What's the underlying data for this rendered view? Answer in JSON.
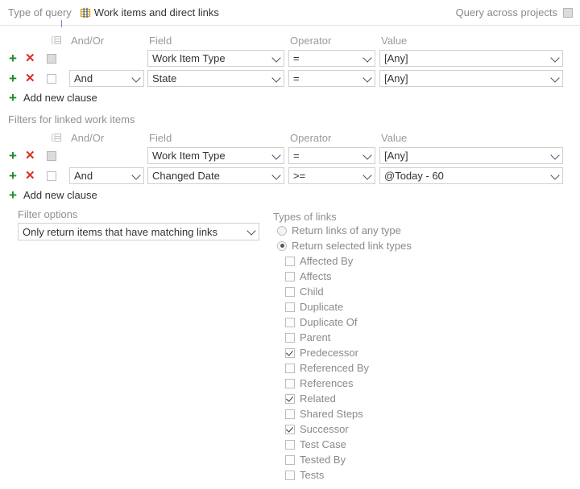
{
  "topbar": {
    "type_of_query_label": "Type of query",
    "query_type_value": "Work items and direct links",
    "query_type_icon": "grid-icon",
    "query_across_projects_label": "Query across projects",
    "query_across_projects_checked": false
  },
  "columns": {
    "and_or": "And/Or",
    "field": "Field",
    "operator": "Operator",
    "value": "Value",
    "group_icon": "group-clauses-icon"
  },
  "top_clauses": {
    "rows": [
      {
        "and_or": "",
        "field": "Work Item Type",
        "operator": "=",
        "value": "[Any]",
        "checked": false,
        "checkbox_state": "grey"
      },
      {
        "and_or": "And",
        "field": "State",
        "operator": "=",
        "value": "[Any]",
        "checked": false,
        "checkbox_state": "normal"
      }
    ],
    "add_new_clause": "Add new clause"
  },
  "linked_section": {
    "title": "Filters for linked work items",
    "rows": [
      {
        "and_or": "",
        "field": "Work Item Type",
        "operator": "=",
        "value": "[Any]",
        "checked": false,
        "checkbox_state": "grey"
      },
      {
        "and_or": "And",
        "field": "Changed Date",
        "operator": ">=",
        "value": "@Today - 60",
        "checked": false,
        "checkbox_state": "normal"
      }
    ],
    "add_new_clause": "Add new clause"
  },
  "filter_options": {
    "label": "Filter options",
    "value": "Only return items that have matching links"
  },
  "types_of_links": {
    "label": "Types of links",
    "radios": [
      {
        "label": "Return links of any type",
        "selected": false
      },
      {
        "label": "Return selected link types",
        "selected": true
      }
    ],
    "checkboxes": [
      {
        "label": "Affected By",
        "checked": false
      },
      {
        "label": "Affects",
        "checked": false
      },
      {
        "label": "Child",
        "checked": false
      },
      {
        "label": "Duplicate",
        "checked": false
      },
      {
        "label": "Duplicate Of",
        "checked": false
      },
      {
        "label": "Parent",
        "checked": false
      },
      {
        "label": "Predecessor",
        "checked": true
      },
      {
        "label": "Referenced By",
        "checked": false
      },
      {
        "label": "References",
        "checked": false
      },
      {
        "label": "Related",
        "checked": true
      },
      {
        "label": "Shared Steps",
        "checked": false
      },
      {
        "label": "Successor",
        "checked": true
      },
      {
        "label": "Test Case",
        "checked": false
      },
      {
        "label": "Tested By",
        "checked": false
      },
      {
        "label": "Tests",
        "checked": false
      }
    ]
  },
  "colors": {
    "add_green": "#1e8b2f",
    "delete_red": "#d93025",
    "label_grey": "#909090",
    "text": "#333333",
    "border": "#d0d0d0",
    "divider": "#e6e6e6",
    "tick_purple": "#8e7cc3"
  }
}
